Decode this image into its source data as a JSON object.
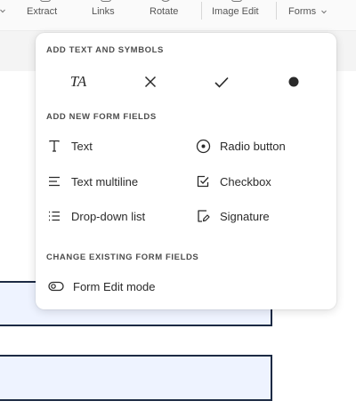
{
  "toolbar": {
    "items": [
      {
        "label": "Extract"
      },
      {
        "label": "Links"
      },
      {
        "label": "Rotate"
      },
      {
        "label": "Image Edit"
      },
      {
        "label": "Forms"
      }
    ]
  },
  "menu": {
    "text_symbols_heading": "ADD TEXT AND SYMBOLS",
    "text_symbols": [
      {
        "label": "TA",
        "icon": "text-annotation-icon"
      },
      {
        "label": "",
        "icon": "cross-mark-icon"
      },
      {
        "label": "",
        "icon": "check-mark-icon"
      },
      {
        "label": "",
        "icon": "dot-icon"
      }
    ],
    "new_fields_heading": "ADD NEW FORM FIELDS",
    "new_fields": [
      {
        "label": "Text",
        "icon": "text-field-icon"
      },
      {
        "label": "Radio button",
        "icon": "radio-button-icon"
      },
      {
        "label": "Text multiline",
        "icon": "text-multiline-icon"
      },
      {
        "label": "Checkbox",
        "icon": "checkbox-icon"
      },
      {
        "label": "Drop-down list",
        "icon": "dropdown-list-icon"
      },
      {
        "label": "Signature",
        "icon": "signature-icon"
      }
    ],
    "existing_heading": "CHANGE EXISTING FORM FIELDS",
    "existing": [
      {
        "label": "Form Edit mode",
        "icon": "toggle-icon"
      }
    ]
  }
}
